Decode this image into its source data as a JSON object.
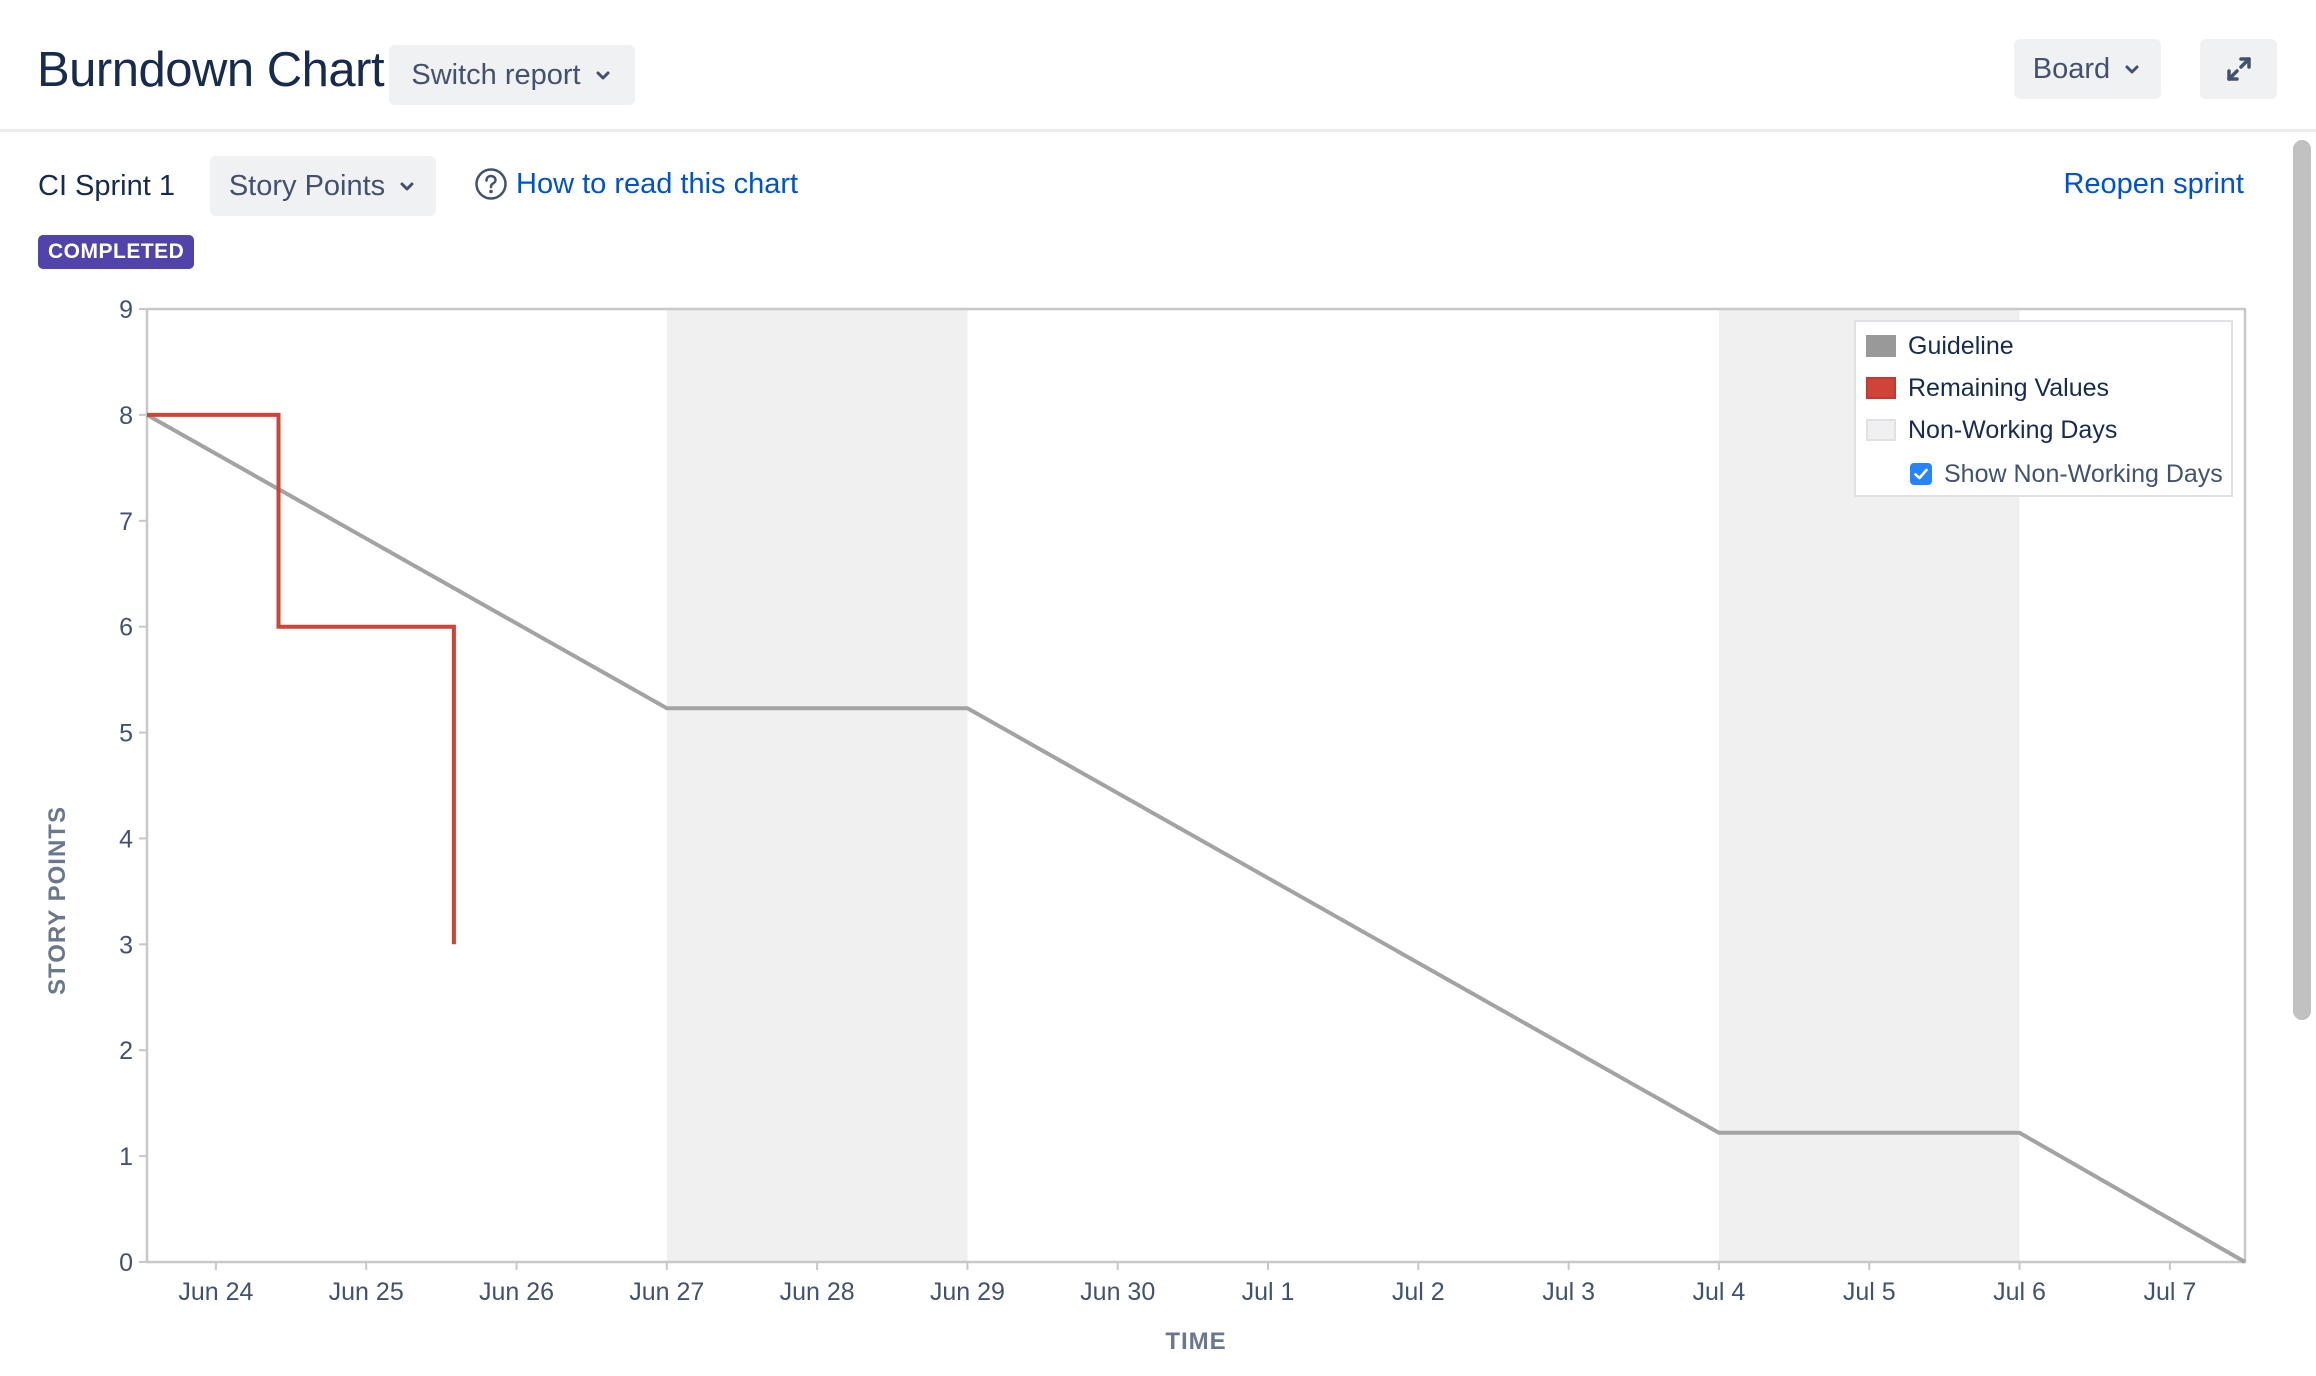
{
  "header": {
    "title": "Burndown Chart",
    "switch_report_label": "Switch report",
    "board_label": "Board"
  },
  "icons": {
    "switch_report_chevron": "chevron-down-icon",
    "board_chevron": "chevron-down-icon",
    "expand": "expand-icon",
    "help": "question-circle-icon",
    "story_points_chevron": "chevron-down-icon",
    "checkbox": "check-icon"
  },
  "sprint": {
    "name": "CI Sprint 1",
    "estimation_label": "Story Points",
    "help_link": "How to read this chart",
    "reopen_label": "Reopen sprint",
    "status": "COMPLETED"
  },
  "legend": {
    "items": [
      {
        "label": "Guideline",
        "color": "#999999"
      },
      {
        "label": "Remaining Values",
        "color": "#d04437"
      },
      {
        "label": "Non-Working Days",
        "color": "#f0f0f0"
      }
    ],
    "toggle_label": "Show Non-Working Days",
    "toggle_checked": true
  },
  "colors": {
    "accent": "#0052cc",
    "status_lozenge": "#5243aa",
    "guideline": "#a3a3a3",
    "remaining": "#d04437",
    "non_working": "#f0f0f0",
    "checkbox": "#2684ff"
  },
  "chart_data": {
    "type": "line",
    "title": "",
    "xlabel": "TIME",
    "ylabel": "STORY POINTS",
    "ylim": [
      0,
      9
    ],
    "xlim": [
      "2018-06-23T13:00",
      "2018-07-07T12:00"
    ],
    "yticks": [
      0,
      1,
      2,
      3,
      4,
      5,
      6,
      7,
      8,
      9
    ],
    "xticks": [
      {
        "date": "2018-06-24",
        "label": "Jun 24"
      },
      {
        "date": "2018-06-25",
        "label": "Jun 25"
      },
      {
        "date": "2018-06-26",
        "label": "Jun 26"
      },
      {
        "date": "2018-06-27",
        "label": "Jun 27"
      },
      {
        "date": "2018-06-28",
        "label": "Jun 28"
      },
      {
        "date": "2018-06-29",
        "label": "Jun 29"
      },
      {
        "date": "2018-06-30",
        "label": "Jun 30"
      },
      {
        "date": "2018-07-01",
        "label": "Jul 1"
      },
      {
        "date": "2018-07-02",
        "label": "Jul 2"
      },
      {
        "date": "2018-07-03",
        "label": "Jul 3"
      },
      {
        "date": "2018-07-04",
        "label": "Jul 4"
      },
      {
        "date": "2018-07-05",
        "label": "Jul 5"
      },
      {
        "date": "2018-07-06",
        "label": "Jul 6"
      },
      {
        "date": "2018-07-07",
        "label": "Jul 7"
      }
    ],
    "non_working_periods": [
      [
        "2018-06-27",
        "2018-06-29"
      ],
      [
        "2018-07-04",
        "2018-07-06"
      ]
    ],
    "series": [
      {
        "name": "Guideline",
        "step": false,
        "points": [
          [
            "2018-06-23T13:00",
            8
          ],
          [
            "2018-06-27T00:00",
            5.23
          ],
          [
            "2018-06-29T00:00",
            5.23
          ],
          [
            "2018-07-04T00:00",
            1.22
          ],
          [
            "2018-07-06T00:00",
            1.22
          ],
          [
            "2018-07-07T12:00",
            0
          ]
        ]
      },
      {
        "name": "Remaining Values",
        "step": true,
        "points": [
          [
            "2018-06-23T13:00",
            8
          ],
          [
            "2018-06-24T10:00",
            8
          ],
          [
            "2018-06-24T10:00",
            6
          ],
          [
            "2018-06-25T14:00",
            6
          ],
          [
            "2018-06-25T14:00",
            3
          ]
        ]
      }
    ],
    "grid": false,
    "legend_position": "top-right"
  }
}
